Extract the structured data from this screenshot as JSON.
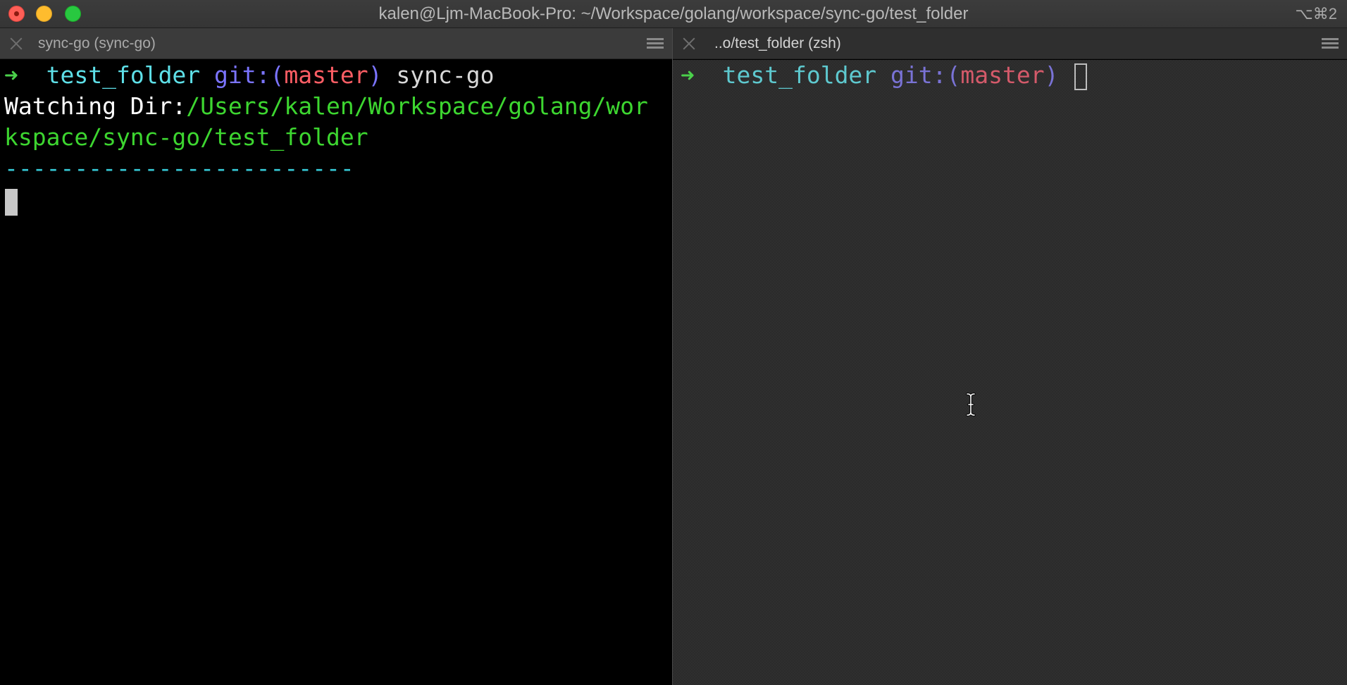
{
  "window": {
    "title": "kalen@Ljm-MacBook-Pro: ~/Workspace/golang/workspace/sync-go/test_folder",
    "shortcut": "⌥⌘2"
  },
  "tabs": {
    "left": {
      "label": "sync-go (sync-go)"
    },
    "right": {
      "label": "..o/test_folder (zsh)"
    }
  },
  "left_pane": {
    "prompt": {
      "arrow": "➜",
      "folder": "test_folder",
      "git_open": "git:(",
      "branch": "master",
      "git_close": ")",
      "command": "sync-go"
    },
    "watching_label": "Watching Dir:",
    "watching_path_line1": "/Users/kalen/Workspace/golang/wor",
    "watching_path_line2": "kspace/sync-go/test_folder",
    "separator": "-------------------------"
  },
  "right_pane": {
    "prompt": {
      "arrow": "➜",
      "folder": "test_folder",
      "git_open": "git:(",
      "branch": "master",
      "git_close": ")"
    }
  }
}
